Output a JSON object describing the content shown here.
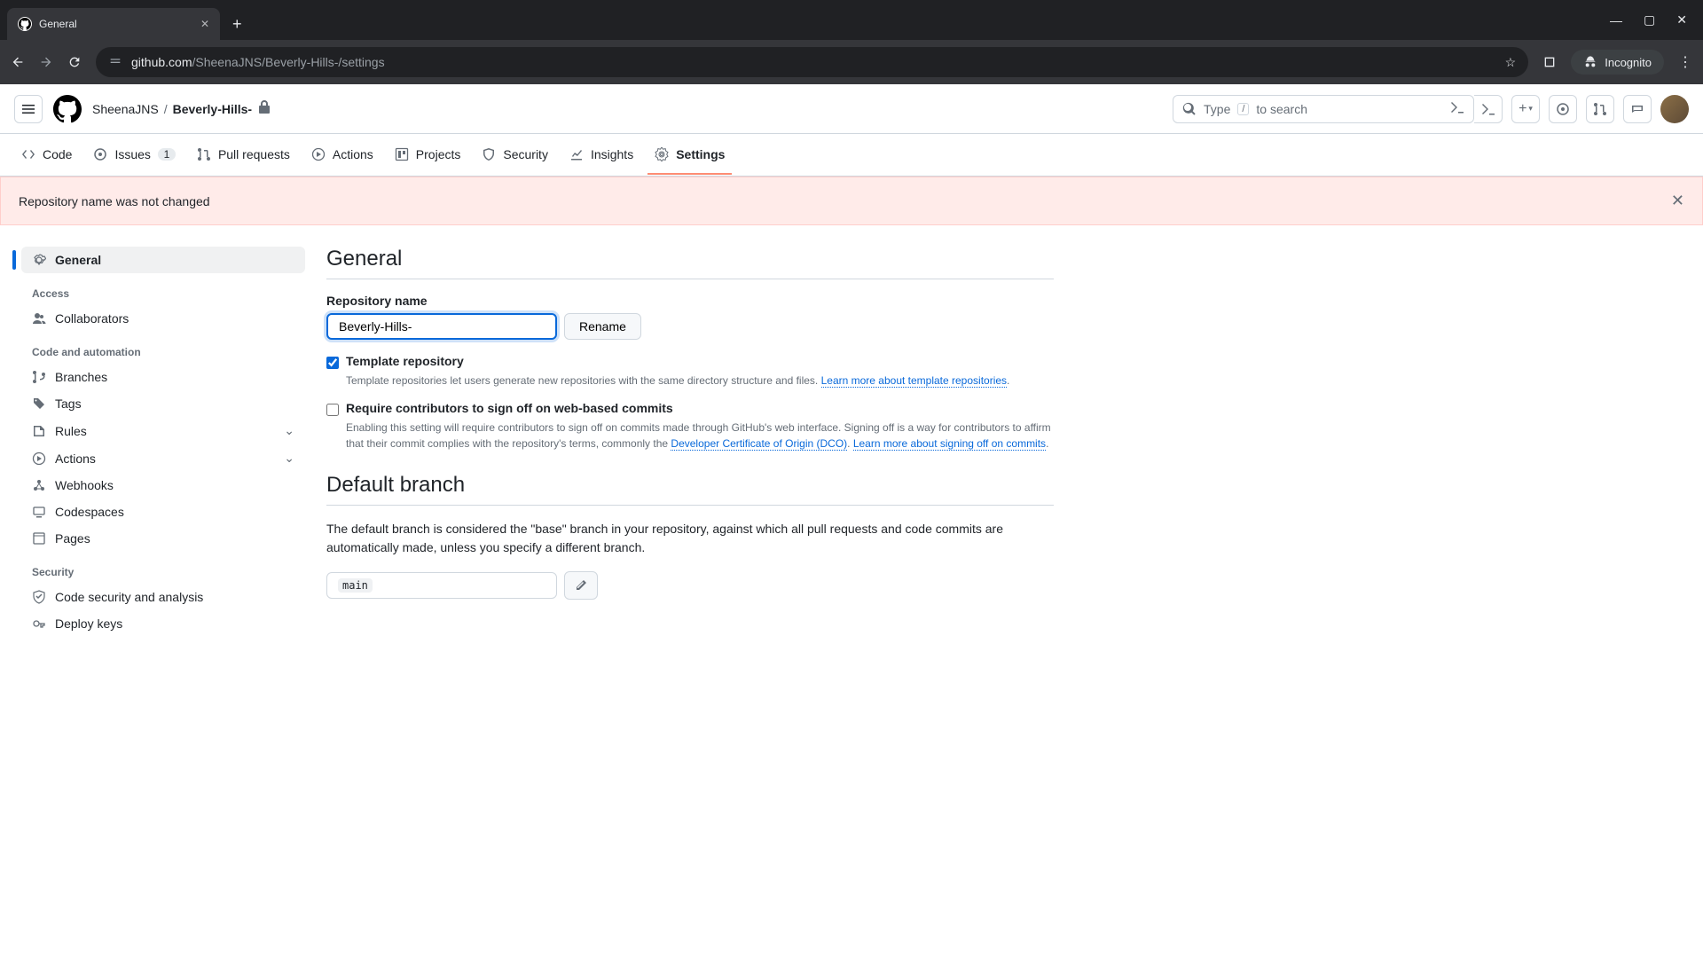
{
  "browser": {
    "tab_title": "General",
    "url_host": "github.com",
    "url_path": "/SheenaJNS/Beverly-Hills-/settings",
    "incognito": "Incognito"
  },
  "header": {
    "owner": "SheenaJNS",
    "repo": "Beverly-Hills-",
    "search_prefix": "Type",
    "search_key": "/",
    "search_suffix": "to search"
  },
  "repo_nav": {
    "code": "Code",
    "issues": "Issues",
    "issues_count": "1",
    "pulls": "Pull requests",
    "actions": "Actions",
    "projects": "Projects",
    "security": "Security",
    "insights": "Insights",
    "settings": "Settings"
  },
  "flash": {
    "message": "Repository name was not changed"
  },
  "sidebar": {
    "general": "General",
    "access_heading": "Access",
    "collaborators": "Collaborators",
    "code_heading": "Code and automation",
    "branches": "Branches",
    "tags": "Tags",
    "rules": "Rules",
    "actions": "Actions",
    "webhooks": "Webhooks",
    "codespaces": "Codespaces",
    "pages": "Pages",
    "security_heading": "Security",
    "code_security": "Code security and analysis",
    "deploy_keys": "Deploy keys"
  },
  "main": {
    "general_title": "General",
    "repo_name_label": "Repository name",
    "repo_name_value": "Beverly-Hills-",
    "rename_btn": "Rename",
    "template_label": "Template repository",
    "template_help": "Template repositories let users generate new repositories with the same directory structure and files.",
    "template_link": "Learn more about template repositories",
    "signoff_label": "Require contributors to sign off on web-based commits",
    "signoff_help1": "Enabling this setting will require contributors to sign off on commits made through GitHub's web interface. Signing off is a way for contributors to affirm that their commit complies with the repository's terms, commonly the ",
    "signoff_link1": "Developer Certificate of Origin (DCO)",
    "signoff_help2": ". ",
    "signoff_link2": "Learn more about signing off on commits",
    "default_branch_title": "Default branch",
    "default_branch_desc": "The default branch is considered the \"base\" branch in your repository, against which all pull requests and code commits are automatically made, unless you specify a different branch.",
    "default_branch_value": "main"
  }
}
